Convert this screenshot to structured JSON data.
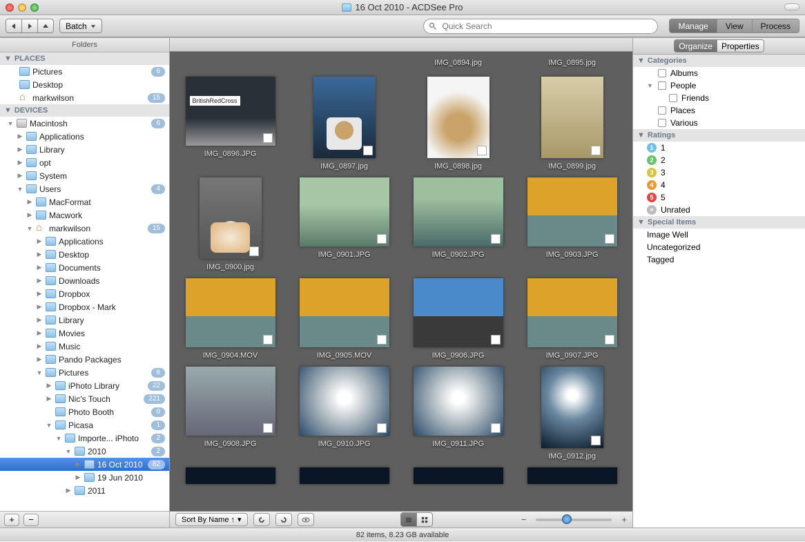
{
  "window": {
    "title": "16 Oct 2010 - ACDSee Pro"
  },
  "toolbar": {
    "batch_label": "Batch",
    "search_placeholder": "Quick Search",
    "tabs": {
      "manage": "Manage",
      "view": "View",
      "process": "Process"
    }
  },
  "left": {
    "panel_title": "Folders",
    "places_header": "PLACES",
    "places": [
      {
        "label": "Pictures",
        "badge": "6"
      },
      {
        "label": "Desktop"
      },
      {
        "label": "markwilson",
        "badge": "15"
      }
    ],
    "devices_header": "DEVICES",
    "tree": [
      {
        "indent": 0,
        "disc": "▼",
        "icon": "hd",
        "label": "Macintosh",
        "badge": "6"
      },
      {
        "indent": 1,
        "disc": "▶",
        "icon": "fold",
        "label": "Applications"
      },
      {
        "indent": 1,
        "disc": "▶",
        "icon": "fold",
        "label": "Library"
      },
      {
        "indent": 1,
        "disc": "▶",
        "icon": "fold",
        "label": "opt"
      },
      {
        "indent": 1,
        "disc": "▶",
        "icon": "fold",
        "label": "System"
      },
      {
        "indent": 1,
        "disc": "▼",
        "icon": "fold",
        "label": "Users",
        "badge": "4"
      },
      {
        "indent": 2,
        "disc": "▶",
        "icon": "fold",
        "label": "MacFormat"
      },
      {
        "indent": 2,
        "disc": "▶",
        "icon": "fold",
        "label": "Macwork"
      },
      {
        "indent": 2,
        "disc": "▼",
        "icon": "home",
        "label": "markwilson",
        "badge": "15"
      },
      {
        "indent": 3,
        "disc": "▶",
        "icon": "fold",
        "label": "Applications"
      },
      {
        "indent": 3,
        "disc": "▶",
        "icon": "fold",
        "label": "Desktop"
      },
      {
        "indent": 3,
        "disc": "▶",
        "icon": "fold",
        "label": "Documents"
      },
      {
        "indent": 3,
        "disc": "▶",
        "icon": "fold",
        "label": "Downloads"
      },
      {
        "indent": 3,
        "disc": "▶",
        "icon": "fold",
        "label": "Dropbox"
      },
      {
        "indent": 3,
        "disc": "▶",
        "icon": "fold",
        "label": "Dropbox - Mark"
      },
      {
        "indent": 3,
        "disc": "▶",
        "icon": "fold",
        "label": "Library"
      },
      {
        "indent": 3,
        "disc": "▶",
        "icon": "fold",
        "label": "Movies"
      },
      {
        "indent": 3,
        "disc": "▶",
        "icon": "fold",
        "label": "Music"
      },
      {
        "indent": 3,
        "disc": "▶",
        "icon": "fold",
        "label": "Pando Packages"
      },
      {
        "indent": 3,
        "disc": "▼",
        "icon": "fold",
        "label": "Pictures",
        "badge": "6"
      },
      {
        "indent": 4,
        "disc": "▶",
        "icon": "fold",
        "label": "iPhoto Library",
        "badge": "22"
      },
      {
        "indent": 4,
        "disc": "▶",
        "icon": "fold",
        "label": "Nic's Touch",
        "badge": "221"
      },
      {
        "indent": 4,
        "disc": "",
        "icon": "fold",
        "label": "Photo Booth",
        "badge": "0"
      },
      {
        "indent": 4,
        "disc": "▼",
        "icon": "fold",
        "label": "Picasa",
        "badge": "1"
      },
      {
        "indent": 5,
        "disc": "▼",
        "icon": "fold",
        "label": "Importe... iPhoto",
        "badge": "2"
      },
      {
        "indent": 6,
        "disc": "▼",
        "icon": "fold",
        "label": "2010",
        "badge": "2"
      },
      {
        "indent": 7,
        "disc": "▶",
        "icon": "fold",
        "label": "16 Oct 2010",
        "badge": "82",
        "selected": true
      },
      {
        "indent": 7,
        "disc": "▶",
        "icon": "fold",
        "label": "19 Jun 2010"
      },
      {
        "indent": 6,
        "disc": "▶",
        "icon": "fold",
        "label": "2011"
      }
    ]
  },
  "center": {
    "top_row": [
      {
        "name": "IMG_0894.jpg"
      },
      {
        "name": "IMG_0895.jpg"
      }
    ],
    "items": [
      {
        "name": "IMG_0896.JPG",
        "cls": "t-redcross"
      },
      {
        "name": "IMG_0897.jpg",
        "cls": "t-donutwin",
        "portrait": true
      },
      {
        "name": "IMG_0898.jpg",
        "cls": "t-donut",
        "portrait": true
      },
      {
        "name": "IMG_0899.jpg",
        "cls": "t-room",
        "portrait": true
      },
      {
        "name": "IMG_0900.jpg",
        "cls": "t-fruit",
        "portrait": true
      },
      {
        "name": "IMG_0901.JPG",
        "cls": "t-river"
      },
      {
        "name": "IMG_0902.JPG",
        "cls": "t-river2"
      },
      {
        "name": "IMG_0903.JPG",
        "cls": "t-beer"
      },
      {
        "name": "IMG_0904.MOV",
        "cls": "t-beer"
      },
      {
        "name": "IMG_0905.MOV",
        "cls": "t-beer"
      },
      {
        "name": "IMG_0906.JPG",
        "cls": "t-balcony"
      },
      {
        "name": "IMG_0907.JPG",
        "cls": "t-beer"
      },
      {
        "name": "IMG_0908.JPG",
        "cls": "t-wine"
      },
      {
        "name": "IMG_0910.JPG",
        "cls": "t-sun"
      },
      {
        "name": "IMG_0911.JPG",
        "cls": "t-sun"
      },
      {
        "name": "IMG_0912.jpg",
        "cls": "t-sunp",
        "portrait": true
      }
    ],
    "bottom_peek": 4,
    "sort_label": "Sort By Name ↑",
    "status": "82 items, 8.23 GB available"
  },
  "right": {
    "tabs": {
      "organize": "Organize",
      "properties": "Properties"
    },
    "categories_header": "Categories",
    "categories": [
      {
        "label": "Albums",
        "sub": false,
        "disc": ""
      },
      {
        "label": "People",
        "sub": false,
        "disc": "▼"
      },
      {
        "label": "Friends",
        "sub": true,
        "disc": ""
      },
      {
        "label": "Places",
        "sub": false,
        "disc": ""
      },
      {
        "label": "Various",
        "sub": false,
        "disc": ""
      }
    ],
    "ratings_header": "Ratings",
    "ratings": [
      {
        "label": "1",
        "cls": "r1"
      },
      {
        "label": "2",
        "cls": "r2"
      },
      {
        "label": "3",
        "cls": "r3"
      },
      {
        "label": "4",
        "cls": "r4"
      },
      {
        "label": "5",
        "cls": "r5"
      },
      {
        "label": "Unrated",
        "cls": "rx",
        "glyph": "×"
      }
    ],
    "special_header": "Special Items",
    "special": [
      "Image Well",
      "Uncategorized",
      "Tagged"
    ]
  }
}
